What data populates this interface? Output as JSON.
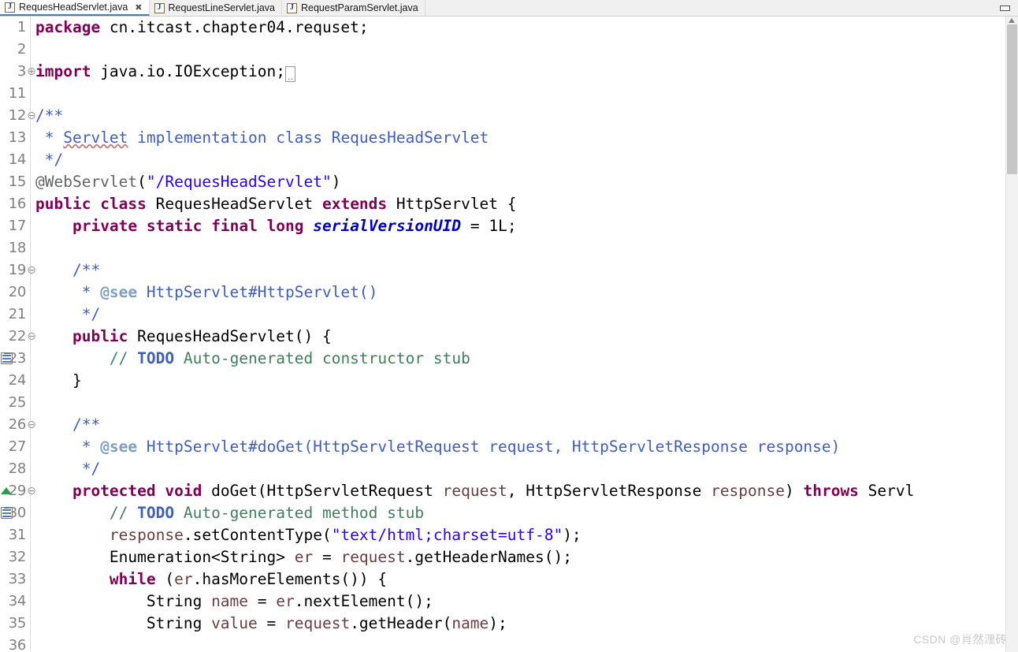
{
  "window": {
    "minimize_label": "▭"
  },
  "tabs": [
    {
      "label": "RequesHeadServlet.java",
      "icon": "java-file-icon",
      "active": true,
      "close_glyph": "✖"
    },
    {
      "label": "RequestLineServlet.java",
      "icon": "java-file-icon",
      "active": false
    },
    {
      "label": "RequestParamServlet.java",
      "icon": "java-file-icon",
      "active": false
    }
  ],
  "editor": {
    "language": "java",
    "file": "RequesHeadServlet.java",
    "fold_collapsed_glyph": "..",
    "lines": [
      {
        "n": "1",
        "fold": "",
        "marker": "",
        "text": "package cn.itcast.chapter04.requset;"
      },
      {
        "n": "2",
        "fold": "",
        "marker": "",
        "text": ""
      },
      {
        "n": "3",
        "fold": "⊕",
        "marker": "",
        "text": "import java.io.IOException;"
      },
      {
        "n": "11",
        "fold": "",
        "marker": "",
        "text": ""
      },
      {
        "n": "12",
        "fold": "⊖",
        "marker": "",
        "text": "/**"
      },
      {
        "n": "13",
        "fold": "",
        "marker": "",
        "text": " * Servlet implementation class RequesHeadServlet"
      },
      {
        "n": "14",
        "fold": "",
        "marker": "",
        "text": " */"
      },
      {
        "n": "15",
        "fold": "",
        "marker": "",
        "text": "@WebServlet(\"/RequesHeadServlet\")"
      },
      {
        "n": "16",
        "fold": "",
        "marker": "",
        "text": "public class RequesHeadServlet extends HttpServlet {"
      },
      {
        "n": "17",
        "fold": "",
        "marker": "",
        "text": "    private static final long serialVersionUID = 1L;"
      },
      {
        "n": "18",
        "fold": "",
        "marker": "",
        "text": ""
      },
      {
        "n": "19",
        "fold": "⊖",
        "marker": "",
        "text": "    /**"
      },
      {
        "n": "20",
        "fold": "",
        "marker": "",
        "text": "     * @see HttpServlet#HttpServlet()"
      },
      {
        "n": "21",
        "fold": "",
        "marker": "",
        "text": "     */"
      },
      {
        "n": "22",
        "fold": "⊖",
        "marker": "",
        "text": "    public RequesHeadServlet() {"
      },
      {
        "n": "23",
        "fold": "",
        "marker": "todo",
        "text": "        // TODO Auto-generated constructor stub"
      },
      {
        "n": "24",
        "fold": "",
        "marker": "",
        "text": "    }"
      },
      {
        "n": "25",
        "fold": "",
        "marker": "",
        "text": ""
      },
      {
        "n": "26",
        "fold": "⊖",
        "marker": "",
        "text": "    /**"
      },
      {
        "n": "27",
        "fold": "",
        "marker": "",
        "text": "     * @see HttpServlet#doGet(HttpServletRequest request, HttpServletResponse response)"
      },
      {
        "n": "28",
        "fold": "",
        "marker": "",
        "text": "     */"
      },
      {
        "n": "29",
        "fold": "⊖",
        "marker": "override",
        "text": "    protected void doGet(HttpServletRequest request, HttpServletResponse response) throws Servl"
      },
      {
        "n": "30",
        "fold": "",
        "marker": "todo",
        "text": "        // TODO Auto-generated method stub"
      },
      {
        "n": "31",
        "fold": "",
        "marker": "",
        "text": "        response.setContentType(\"text/html;charset=utf-8\");"
      },
      {
        "n": "32",
        "fold": "",
        "marker": "",
        "text": "        Enumeration<String> er = request.getHeaderNames();"
      },
      {
        "n": "33",
        "fold": "",
        "marker": "",
        "text": "        while (er.hasMoreElements()) {"
      },
      {
        "n": "34",
        "fold": "",
        "marker": "",
        "text": "            String name = er.nextElement();"
      },
      {
        "n": "35",
        "fold": "",
        "marker": "",
        "text": "            String value = request.getHeader(name);"
      },
      {
        "n": "36",
        "fold": "",
        "marker": "",
        "text": ""
      }
    ]
  },
  "colors": {
    "keyword": "#7f0055",
    "string": "#2a00ff",
    "comment": "#3f7f5f",
    "javadoc": "#3f5fbf",
    "javadoc_tag": "#7f9fbf",
    "field": "#0000c0",
    "parameter": "#6a3e3e",
    "annotation": "#646464",
    "line_number": "#808080",
    "tab_active_underline": "#4a7ebb",
    "marker_override": "#2e9c52",
    "background": "#ffffff"
  },
  "watermark": {
    "text": "CSDN @肖然浬砖"
  }
}
